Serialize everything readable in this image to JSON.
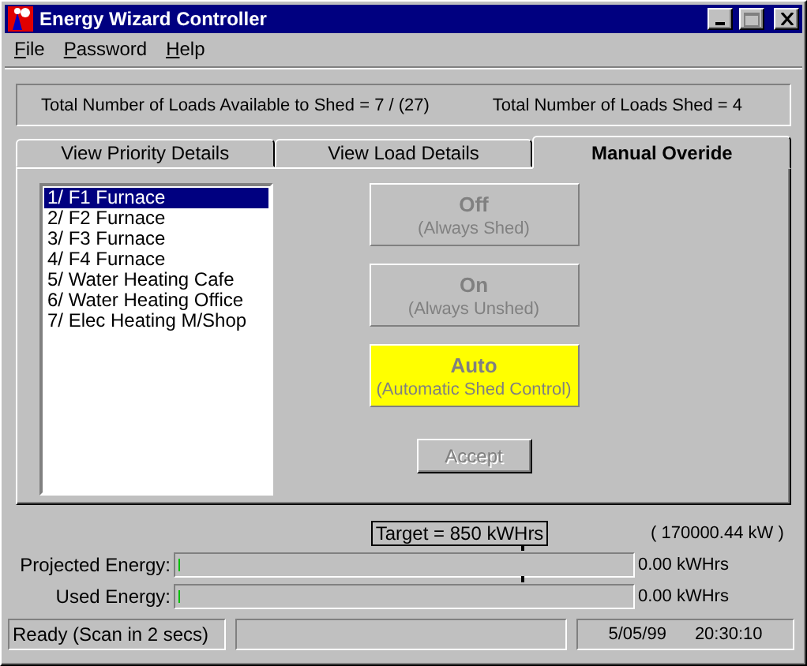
{
  "window": {
    "title": "Energy Wizard Controller"
  },
  "menu": [
    "File",
    "Password",
    "Help"
  ],
  "summary": {
    "available": "Total Number of Loads Available to Shed = 7 / (27)",
    "shed": "Total Number of Loads Shed = 4"
  },
  "tabs": [
    {
      "label": "View Priority Details",
      "selected": false
    },
    {
      "label": "View Load Details",
      "selected": false
    },
    {
      "label": "Manual Overide",
      "selected": true
    }
  ],
  "loads": [
    {
      "label": "1/ F1 Furnace",
      "selected": true
    },
    {
      "label": "2/ F2 Furnace",
      "selected": false
    },
    {
      "label": "3/ F3 Furnace",
      "selected": false
    },
    {
      "label": "4/ F4 Furnace",
      "selected": false
    },
    {
      "label": "5/ Water Heating Cafe",
      "selected": false
    },
    {
      "label": "6/ Water Heating Office",
      "selected": false
    },
    {
      "label": "7/ Elec Heating M/Shop",
      "selected": false
    }
  ],
  "modes": [
    {
      "title": "Off",
      "subtitle": "(Always Shed)",
      "selected": false,
      "disabled": true
    },
    {
      "title": "On",
      "subtitle": "(Always Unshed)",
      "selected": false,
      "disabled": true
    },
    {
      "title": "Auto",
      "subtitle": "(Automatic Shed Control)",
      "selected": true,
      "disabled": true
    }
  ],
  "accept": {
    "label": "Accept",
    "disabled": true
  },
  "target": {
    "label": "Target = 850 kWHrs",
    "power": "( 170000.44 kW )"
  },
  "meters": [
    {
      "label": "Projected Energy:",
      "level": 0.01,
      "reading": "0.00 kWHrs"
    },
    {
      "label": "Used Energy:",
      "level": 0.01,
      "reading": "0.00 kWHrs"
    }
  ],
  "status_bar": {
    "message": "Ready (Scan in 2 secs)",
    "date": "5/05/99",
    "time": "20:30:10"
  }
}
